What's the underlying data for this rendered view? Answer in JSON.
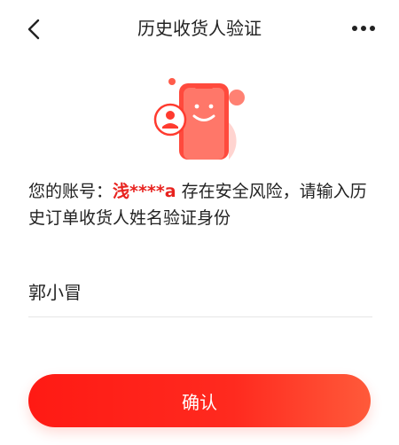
{
  "header": {
    "title": "历史收货人验证",
    "back_icon": "chevron-left-icon",
    "more_icon": "more-dots-icon"
  },
  "illustration": {
    "icon": "phone-avatar-illustration"
  },
  "warning": {
    "prefix": "您的账号：",
    "account": "浅****a",
    "suffix": " 存在安全风险，请输入历史订单收货人姓名验证身份"
  },
  "name_input": {
    "value": "郭小冒"
  },
  "confirm_button": {
    "label": "确认"
  },
  "colors": {
    "accent": "#e8231f",
    "button_start": "#ff1a14",
    "button_end": "#ff5a3a"
  }
}
